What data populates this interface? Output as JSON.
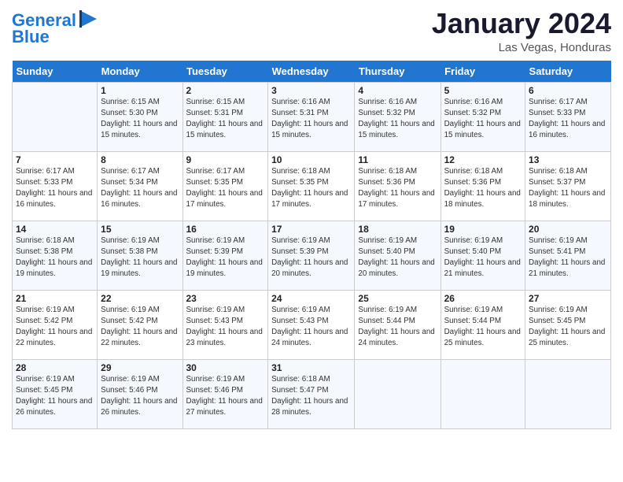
{
  "header": {
    "logo_line1": "General",
    "logo_line2": "Blue",
    "month": "January 2024",
    "location": "Las Vegas, Honduras"
  },
  "weekdays": [
    "Sunday",
    "Monday",
    "Tuesday",
    "Wednesday",
    "Thursday",
    "Friday",
    "Saturday"
  ],
  "weeks": [
    [
      {
        "day": "",
        "sunrise": "",
        "sunset": "",
        "daylight": ""
      },
      {
        "day": "1",
        "sunrise": "6:15 AM",
        "sunset": "5:30 PM",
        "daylight": "11 hours and 15 minutes."
      },
      {
        "day": "2",
        "sunrise": "6:15 AM",
        "sunset": "5:31 PM",
        "daylight": "11 hours and 15 minutes."
      },
      {
        "day": "3",
        "sunrise": "6:16 AM",
        "sunset": "5:31 PM",
        "daylight": "11 hours and 15 minutes."
      },
      {
        "day": "4",
        "sunrise": "6:16 AM",
        "sunset": "5:32 PM",
        "daylight": "11 hours and 15 minutes."
      },
      {
        "day": "5",
        "sunrise": "6:16 AM",
        "sunset": "5:32 PM",
        "daylight": "11 hours and 15 minutes."
      },
      {
        "day": "6",
        "sunrise": "6:17 AM",
        "sunset": "5:33 PM",
        "daylight": "11 hours and 16 minutes."
      }
    ],
    [
      {
        "day": "7",
        "sunrise": "6:17 AM",
        "sunset": "5:33 PM",
        "daylight": "11 hours and 16 minutes."
      },
      {
        "day": "8",
        "sunrise": "6:17 AM",
        "sunset": "5:34 PM",
        "daylight": "11 hours and 16 minutes."
      },
      {
        "day": "9",
        "sunrise": "6:17 AM",
        "sunset": "5:35 PM",
        "daylight": "11 hours and 17 minutes."
      },
      {
        "day": "10",
        "sunrise": "6:18 AM",
        "sunset": "5:35 PM",
        "daylight": "11 hours and 17 minutes."
      },
      {
        "day": "11",
        "sunrise": "6:18 AM",
        "sunset": "5:36 PM",
        "daylight": "11 hours and 17 minutes."
      },
      {
        "day": "12",
        "sunrise": "6:18 AM",
        "sunset": "5:36 PM",
        "daylight": "11 hours and 18 minutes."
      },
      {
        "day": "13",
        "sunrise": "6:18 AM",
        "sunset": "5:37 PM",
        "daylight": "11 hours and 18 minutes."
      }
    ],
    [
      {
        "day": "14",
        "sunrise": "6:18 AM",
        "sunset": "5:38 PM",
        "daylight": "11 hours and 19 minutes."
      },
      {
        "day": "15",
        "sunrise": "6:19 AM",
        "sunset": "5:38 PM",
        "daylight": "11 hours and 19 minutes."
      },
      {
        "day": "16",
        "sunrise": "6:19 AM",
        "sunset": "5:39 PM",
        "daylight": "11 hours and 19 minutes."
      },
      {
        "day": "17",
        "sunrise": "6:19 AM",
        "sunset": "5:39 PM",
        "daylight": "11 hours and 20 minutes."
      },
      {
        "day": "18",
        "sunrise": "6:19 AM",
        "sunset": "5:40 PM",
        "daylight": "11 hours and 20 minutes."
      },
      {
        "day": "19",
        "sunrise": "6:19 AM",
        "sunset": "5:40 PM",
        "daylight": "11 hours and 21 minutes."
      },
      {
        "day": "20",
        "sunrise": "6:19 AM",
        "sunset": "5:41 PM",
        "daylight": "11 hours and 21 minutes."
      }
    ],
    [
      {
        "day": "21",
        "sunrise": "6:19 AM",
        "sunset": "5:42 PM",
        "daylight": "11 hours and 22 minutes."
      },
      {
        "day": "22",
        "sunrise": "6:19 AM",
        "sunset": "5:42 PM",
        "daylight": "11 hours and 22 minutes."
      },
      {
        "day": "23",
        "sunrise": "6:19 AM",
        "sunset": "5:43 PM",
        "daylight": "11 hours and 23 minutes."
      },
      {
        "day": "24",
        "sunrise": "6:19 AM",
        "sunset": "5:43 PM",
        "daylight": "11 hours and 24 minutes."
      },
      {
        "day": "25",
        "sunrise": "6:19 AM",
        "sunset": "5:44 PM",
        "daylight": "11 hours and 24 minutes."
      },
      {
        "day": "26",
        "sunrise": "6:19 AM",
        "sunset": "5:44 PM",
        "daylight": "11 hours and 25 minutes."
      },
      {
        "day": "27",
        "sunrise": "6:19 AM",
        "sunset": "5:45 PM",
        "daylight": "11 hours and 25 minutes."
      }
    ],
    [
      {
        "day": "28",
        "sunrise": "6:19 AM",
        "sunset": "5:45 PM",
        "daylight": "11 hours and 26 minutes."
      },
      {
        "day": "29",
        "sunrise": "6:19 AM",
        "sunset": "5:46 PM",
        "daylight": "11 hours and 26 minutes."
      },
      {
        "day": "30",
        "sunrise": "6:19 AM",
        "sunset": "5:46 PM",
        "daylight": "11 hours and 27 minutes."
      },
      {
        "day": "31",
        "sunrise": "6:18 AM",
        "sunset": "5:47 PM",
        "daylight": "11 hours and 28 minutes."
      },
      {
        "day": "",
        "sunrise": "",
        "sunset": "",
        "daylight": ""
      },
      {
        "day": "",
        "sunrise": "",
        "sunset": "",
        "daylight": ""
      },
      {
        "day": "",
        "sunrise": "",
        "sunset": "",
        "daylight": ""
      }
    ]
  ],
  "labels": {
    "sunrise": "Sunrise:",
    "sunset": "Sunset:",
    "daylight": "Daylight:"
  }
}
